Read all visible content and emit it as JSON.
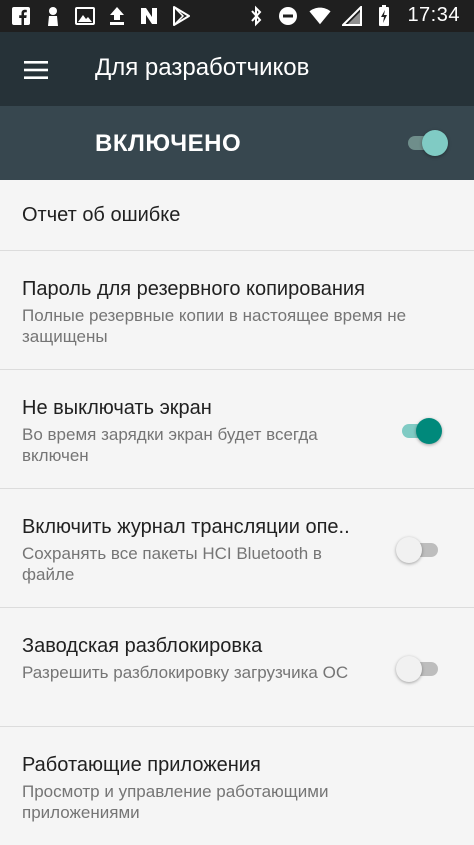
{
  "status_bar": {
    "left_icons": [
      "facebook-icon",
      "person-icon",
      "image-icon",
      "upload-icon",
      "n-icon",
      "play-store-icon"
    ],
    "right_icons": [
      "bluetooth-icon",
      "do-not-disturb-icon",
      "wifi-icon",
      "signal-icon",
      "battery-icon"
    ],
    "time": "17:34"
  },
  "toolbar": {
    "title": "Для разработчиков"
  },
  "master_toggle": {
    "label": "ВКЛЮЧЕНО",
    "on": true
  },
  "items": [
    {
      "title": "Отчет об ошибке",
      "subtitle": ""
    },
    {
      "title": "Пароль для резервного копирования",
      "subtitle": "Полные резервные копии в настоящее время не защищены"
    },
    {
      "title": "Не выключать экран",
      "subtitle": "Во время зарядки экран будет всегда включен",
      "switch": true
    },
    {
      "title": "Включить журнал трансляции опе..",
      "subtitle": "Сохранять все пакеты HCI Bluetooth в файле",
      "switch": false
    },
    {
      "title": "Заводская разблокировка",
      "subtitle": "Разрешить разблокировку загрузчика ОС",
      "switch": false
    },
    {
      "title": "Работающие приложения",
      "subtitle": "Просмотр и управление работающими приложениями"
    }
  ],
  "colors": {
    "status_bar": "#1f1f1f",
    "toolbar": "#263238",
    "master_bar": "#37474f",
    "accent": "#00897b",
    "background": "#f5f5f5"
  }
}
